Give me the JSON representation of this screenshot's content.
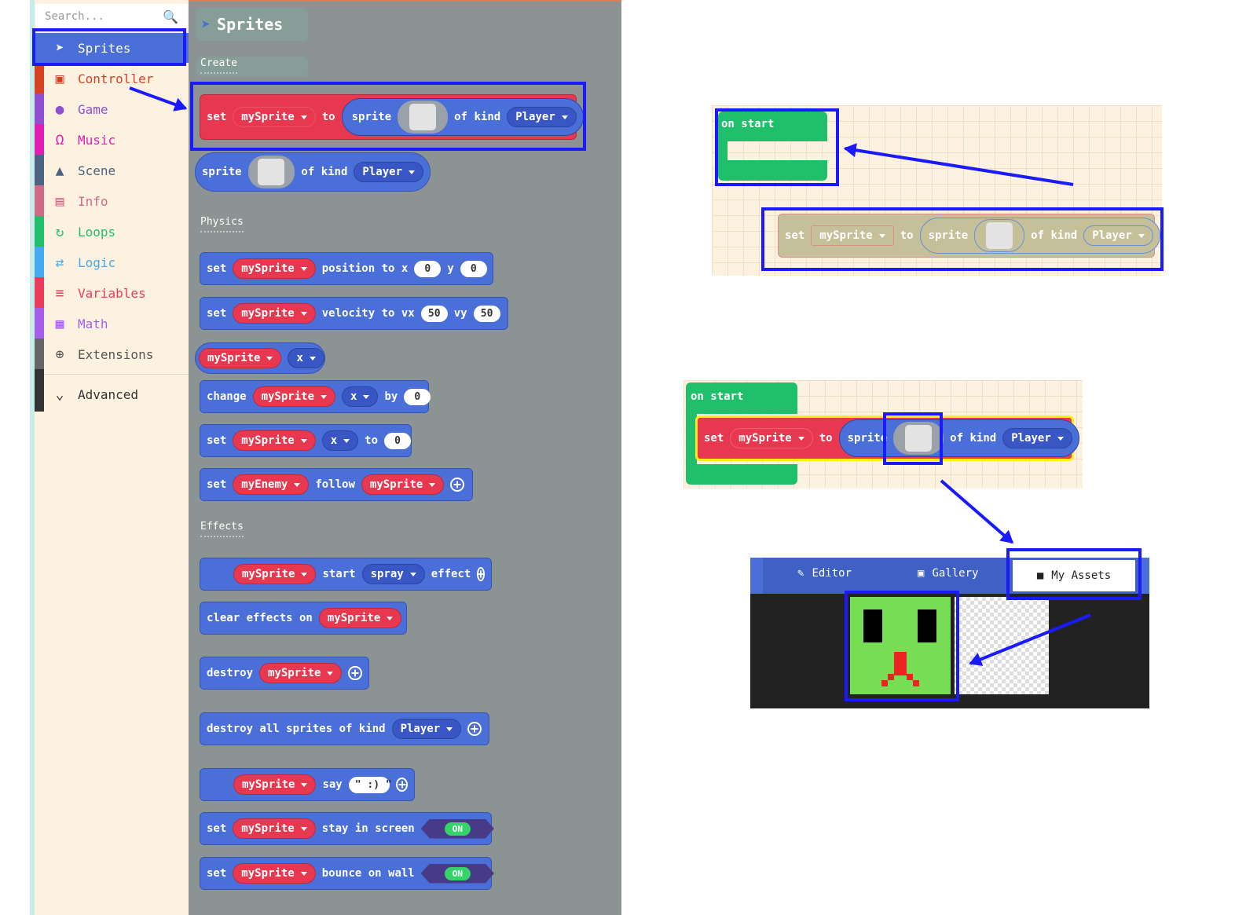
{
  "search": {
    "placeholder": "Search..."
  },
  "categories": [
    {
      "label": "Sprites",
      "icon": "paper-plane-icon",
      "color": "#4a6fd9"
    },
    {
      "label": "Controller",
      "icon": "gamepad-icon",
      "color": "#d54322"
    },
    {
      "label": "Game",
      "icon": "circle-icon",
      "color": "#8f4fd0"
    },
    {
      "label": "Music",
      "icon": "headphones-icon",
      "color": "#e01eb1"
    },
    {
      "label": "Scene",
      "icon": "tree-icon",
      "color": "#4c6281"
    },
    {
      "label": "Info",
      "icon": "id-card-icon",
      "color": "#cf6a87"
    },
    {
      "label": "Loops",
      "icon": "refresh-icon",
      "color": "#20bf6b"
    },
    {
      "label": "Logic",
      "icon": "shuffle-icon",
      "color": "#45aaf2"
    },
    {
      "label": "Variables",
      "icon": "list-icon",
      "color": "#eb3b5a"
    },
    {
      "label": "Math",
      "icon": "calculator-icon",
      "color": "#a55eea"
    },
    {
      "label": "Extensions",
      "icon": "plus-circle-icon",
      "color": "#666666"
    },
    {
      "label": "Advanced",
      "icon": "chevron-down-icon",
      "color": "#333333"
    }
  ],
  "flyout": {
    "title": "Sprites",
    "sections": {
      "create": "Create",
      "physics": "Physics",
      "effects": "Effects"
    },
    "words": {
      "set": "set",
      "to": "to",
      "sprite": "sprite",
      "of_kind": "of kind",
      "position_to_x": "position to x",
      "y": "y",
      "velocity_to_vx": "velocity to vx",
      "vy": "vy",
      "change": "change",
      "by": "by",
      "follow": "follow",
      "start": "start",
      "effect": "effect",
      "clear_effects_on": "clear effects on",
      "destroy": "destroy",
      "destroy_all": "destroy all sprites of kind",
      "say": "say",
      "stay_in_screen": "stay in screen",
      "bounce_on_wall": "bounce on wall"
    },
    "values": {
      "mySprite": "mySprite",
      "myEnemy": "myEnemy",
      "Player": "Player",
      "x": "x",
      "zero": "0",
      "fifty": "50",
      "spray": "spray",
      "smile": "\" :) \"",
      "on": "ON"
    }
  },
  "workspace": {
    "on_start": "on start",
    "tabs": {
      "editor": "Editor",
      "gallery": "Gallery",
      "my_assets": "My Assets"
    }
  },
  "colors": {
    "annotation": "#1a1aff",
    "flyout_bg": "#8c9393",
    "toolbox_bg": "#fdf1e0",
    "loops_green": "#20bf6b"
  }
}
